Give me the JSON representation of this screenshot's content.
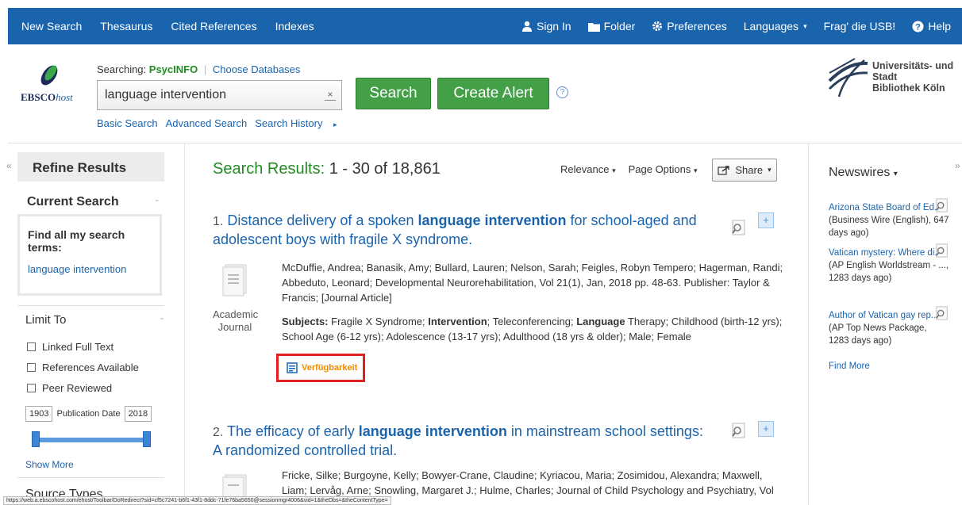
{
  "topnav": {
    "left": [
      "New Search",
      "Thesaurus",
      "Cited References",
      "Indexes"
    ],
    "sign_in": "Sign In",
    "folder": "Folder",
    "preferences": "Preferences",
    "languages": "Languages",
    "frag": "Frag' die USB!",
    "help": "Help"
  },
  "header": {
    "logo": "EBSCOhost",
    "logo_a": "EBSCO",
    "logo_b": "host",
    "searching_label": "Searching:",
    "database": "PsycINFO",
    "choose_db": "Choose Databases",
    "query": "language intervention",
    "search_btn": "Search",
    "alert_btn": "Create Alert",
    "help_q": "?",
    "sublinks": [
      "Basic Search",
      "Advanced Search",
      "Search History"
    ],
    "library": [
      "Universitäts- und",
      "Stadt",
      "Bibliothek Köln"
    ]
  },
  "sidebar": {
    "refine": "Refine Results",
    "current_search": "Current Search",
    "find_all": "Find all my search terms:",
    "current_term": "language intervention",
    "limit_to": "Limit To",
    "limits": [
      "Linked Full Text",
      "References Available",
      "Peer Reviewed"
    ],
    "date_from": "1903",
    "date_label": "Publication Date",
    "date_to": "2018",
    "show_more": "Show More",
    "source_types": "Source Types"
  },
  "results": {
    "heading": "Search Results:",
    "range": "1 - 30 of 18,861",
    "relevance": "Relevance",
    "page_options": "Page Options",
    "share": "Share",
    "items": [
      {
        "num": "1.",
        "title_a": "Distance delivery of a spoken",
        "title_b": "language intervention",
        "title_c": "for school-aged and adolescent boys with fragile X syndrome.",
        "authors": "McDuffie, Andrea; Banasik, Amy; Bullard, Lauren; Nelson, Sarah; Feigles, Robyn Tempero; Hagerman, Randi; Abbeduto, Leonard; Developmental Neurorehabilitation, Vol 21(1), Jan, 2018 pp. 48-63. Publisher: Taylor & Francis; [Journal Article]",
        "pubtype": "Academic Journal",
        "subjects_label": "Subjects:",
        "subj_1": "Fragile X Syndrome;",
        "subj_2": "Intervention",
        "subj_3": "; Teleconferencing;",
        "subj_4": "Language",
        "subj_5": "Therapy; Childhood (birth-12 yrs); School Age (6-12 yrs); Adolescence (13-17 yrs); Adulthood (18 yrs & older); Male; Female",
        "availability": "Verfügbarkeit"
      },
      {
        "num": "2.",
        "title_a": "The efficacy of early",
        "title_b": "language intervention",
        "title_c": "in mainstream school settings: A randomized controlled trial.",
        "authors": "Fricke, Silke; Burgoyne, Kelly; Bowyer-Crane, Claudine; Kyriacou, Maria; Zosimidou, Alexandra; Maxwell, Liam; Lervåg, Arne; Snowling, Margaret J.; Hulme, Charles; Journal of Child Psychology and Psychiatry, Vol"
      }
    ]
  },
  "newswires": {
    "heading": "Newswires",
    "items": [
      {
        "link": "Arizona State Board of Ed...",
        "meta": "(Business Wire (English), 647 days ago)"
      },
      {
        "link": "Vatican mystery: Where di...",
        "meta": "(AP English Worldstream - ..., 1283 days ago)"
      },
      {
        "link": "Author of Vatican gay rep...",
        "meta": "(AP Top News Package, 1283 days ago)"
      }
    ],
    "find_more": "Find More"
  },
  "status_url": "https://web.a.ebscohost.com/ehost/Toolbar/DoRedirect?sid=cf5c7241-b6f1-43f1-8ddc-71fe76ba5650@sessionmgr4006&vid=1&theDbs=&theContentType="
}
